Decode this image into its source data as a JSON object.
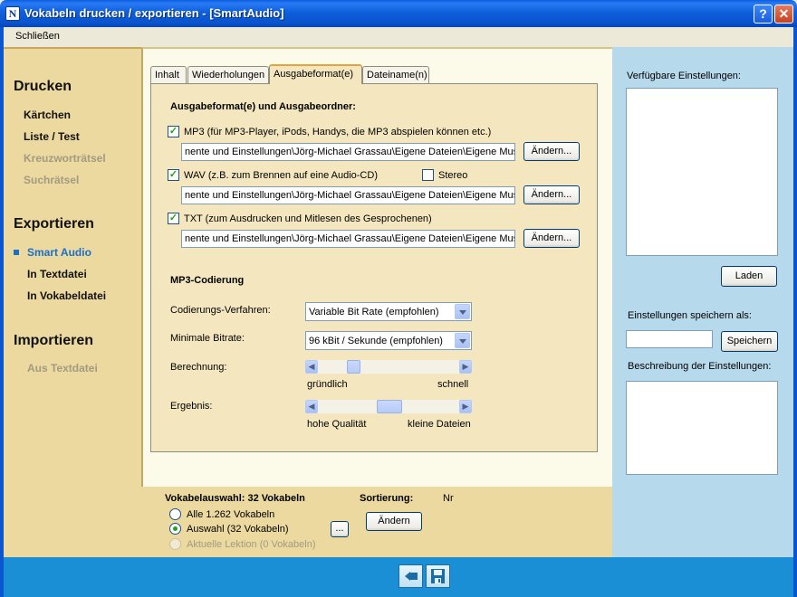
{
  "window": {
    "title": "Vokabeln drucken / exportieren - [SmartAudio]",
    "help_label": "?",
    "close_label": "✕",
    "app_icon_glyph": "N"
  },
  "menu": {
    "close": "Schließen"
  },
  "nav": {
    "print_header": "Drucken",
    "print_items": [
      "Kärtchen",
      "Liste / Test",
      "Kreuzworträtsel",
      "Suchrätsel"
    ],
    "export_header": "Exportieren",
    "export_items": [
      "Smart Audio",
      "In Textdatei",
      "In Vokabeldatei"
    ],
    "import_header": "Importieren",
    "import_items": [
      "Aus Textdatei"
    ]
  },
  "tabs": [
    "Inhalt",
    "Wiederholungen",
    "Ausgabeformat(e)",
    "Dateiname(n)"
  ],
  "output": {
    "section_title": "Ausgabeformat(e) und Ausgabeordner:",
    "mp3_label": "MP3 (für MP3-Player, iPods, Handys, die MP3 abspielen können etc.)",
    "mp3_path": "nente und Einstellungen\\Jörg-Michael Grassau\\Eigene Dateien\\Eigene Musik",
    "wav_label": "WAV (z.B. zum Brennen auf eine Audio-CD)",
    "stereo_label": "Stereo",
    "wav_path": "nente und Einstellungen\\Jörg-Michael Grassau\\Eigene Dateien\\Eigene Musik",
    "txt_label": "TXT (zum Ausdrucken und Mitlesen des Gesprochenen)",
    "txt_path": "nente und Einstellungen\\Jörg-Michael Grassau\\Eigene Dateien\\Eigene Musik",
    "change_label": "Ändern...",
    "check_glyph": "✓"
  },
  "mp3": {
    "section_title": "MP3-Codierung",
    "method_label": "Codierungs-Verfahren:",
    "method_value": "Variable Bit Rate (empfohlen)",
    "bitrate_label": "Minimale Bitrate:",
    "bitrate_value": "96 kBit / Sekunde (empfohlen)",
    "calc_label": "Berechnung:",
    "calc_left": "gründlich",
    "calc_right": "schnell",
    "result_label": "Ergebnis:",
    "result_left": "hohe Qualität",
    "result_right": "kleine Dateien",
    "arrow_left": "◀",
    "arrow_right": "▶"
  },
  "right": {
    "available_label": "Verfügbare Einstellungen:",
    "load_label": "Laden",
    "save_as_label": "Einstellungen speichern als:",
    "save_label": "Speichern",
    "description_label": "Beschreibung der Einstellungen:"
  },
  "selection": {
    "title": "Vokabelauswahl: 32 Vokabeln",
    "all": "Alle 1.262 Vokabeln",
    "selected": "Auswahl (32 Vokabeln)",
    "current": "Aktuelle Lektion (0 Vokabeln)",
    "dots": "...",
    "sort_label": "Sortierung:",
    "sort_value": "Nr",
    "change_label": "Ändern"
  },
  "colors": {
    "titlebar": "#0a55d0",
    "nav_bg": "#ecd9a0",
    "panel_bg": "#f4e7c0",
    "right_bg": "#b7d9ec",
    "footer": "#1a8fd5",
    "accent": "#1a70c7"
  }
}
